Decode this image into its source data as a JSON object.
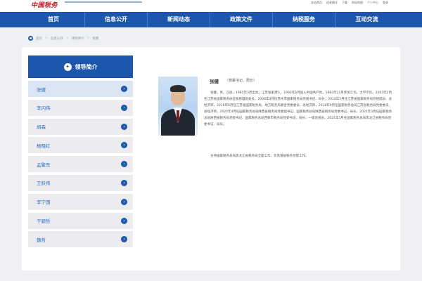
{
  "header": {
    "logo_text": "中国税务",
    "links": [
      "本站首页",
      "适老模式",
      "下载",
      "网站地图",
      "个人中心",
      "登录"
    ]
  },
  "nav": {
    "items": [
      "首页",
      "信息公开",
      "新闻动态",
      "政策文件",
      "纳税服务",
      "互动交流"
    ]
  },
  "breadcrumb": [
    "首页",
    "信息公开",
    "领导简介",
    "张健"
  ],
  "sidebar": {
    "title": "领导简介",
    "items": [
      "张健",
      "李闪伟",
      "胡森",
      "杨晓红",
      "孟繁东",
      "王跃伟",
      "李宁国",
      "于颖哲",
      "魏哲"
    ],
    "active_index": 0
  },
  "profile": {
    "name": "张健",
    "role": "（党委书记、局长）",
    "bio_paragraph_1": "张健，男，汉族，1965年3月出生，江苏张家港人，1992年6月加入中国共产党，1983年11月参加工作，大学学历。2003年2月任江苏省国家税务局征收管理处处长，2006年4月任苏州市国家税务局党组书记、局长，2014年5月任江苏省国家税务局党组成员、总经济师，2016年6月任江苏省国家税务局、地方税务局联合党委委员、总经济师，2018年9月任国家税务总局江苏省税务局党委委员、总经济师，2020年4月任国家税务总局陕西省税务局党委副书记、国家税务总局陕西省税务局党委书记、局长，2021年3月任国家税务总局陕西省税务局党委书记、国家税务总局西安市税务局党委书记、局长，一级巡视员，2021年5月任国家税务总局黑龙江省税务局党委书记、局长。",
    "bio_paragraph_2": "主持国家税务总局黑龙江省税务局全面工作，负责基层税务党建工作。"
  },
  "colors": {
    "nav_blue": "#1c57ad",
    "logo_red": "#c8161d",
    "page_bg": "#eef0f4",
    "sidebar_item_bg": "#ececf0",
    "sidebar_active_bg": "#dbe6f4"
  },
  "icons": {
    "breadcrumb": "location-pin-icon",
    "sidebar_head": "compass-icon",
    "sidebar_item": "chevron-right-circle-icon"
  }
}
